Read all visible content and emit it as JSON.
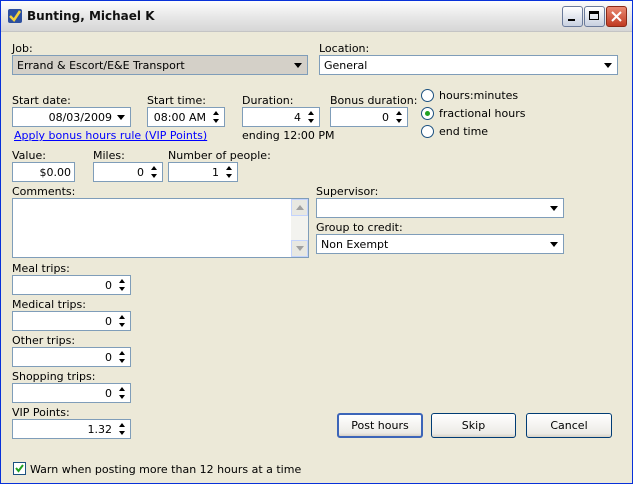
{
  "window": {
    "title": "Bunting, Michael K"
  },
  "job": {
    "label": "Job:",
    "value": "Errand & Escort/E&E Transport"
  },
  "location": {
    "label": "Location:",
    "value": "General"
  },
  "start_date": {
    "label": "Start date:",
    "value": "08/03/2009"
  },
  "start_time": {
    "label": "Start time:",
    "value": "08:00 AM"
  },
  "duration": {
    "label": "Duration:",
    "value": "4",
    "ending": "ending 12:00 PM"
  },
  "bonus_duration": {
    "label": "Bonus duration:",
    "value": "0"
  },
  "time_mode": {
    "options": [
      "hours:minutes",
      "fractional hours",
      "end time"
    ],
    "selected": "fractional hours"
  },
  "bonus_link": "Apply bonus hours rule (VIP Points)",
  "value_field": {
    "label": "Value:",
    "value": "$0.00"
  },
  "miles": {
    "label": "Miles:",
    "value": "0"
  },
  "people": {
    "label": "Number of people:",
    "value": "1"
  },
  "comments": {
    "label": "Comments:",
    "value": ""
  },
  "supervisor": {
    "label": "Supervisor:",
    "value": ""
  },
  "group": {
    "label": "Group to credit:",
    "value": "Non Exempt"
  },
  "meal_trips": {
    "label": "Meal trips:",
    "value": "0"
  },
  "medical_trips": {
    "label": "Medical trips:",
    "value": "0"
  },
  "other_trips": {
    "label": "Other trips:",
    "value": "0"
  },
  "shopping_trips": {
    "label": "Shopping trips:",
    "value": "0"
  },
  "vip_points": {
    "label": "VIP Points:",
    "value": "1.32"
  },
  "buttons": {
    "post": "Post hours",
    "skip": "Skip",
    "cancel": "Cancel"
  },
  "warn": {
    "label": "Warn when posting more than 12 hours at a time",
    "checked": true
  },
  "colors": {
    "accent": "#3c65b8",
    "link": "#0000ff",
    "radio_dot": "#21a121"
  }
}
